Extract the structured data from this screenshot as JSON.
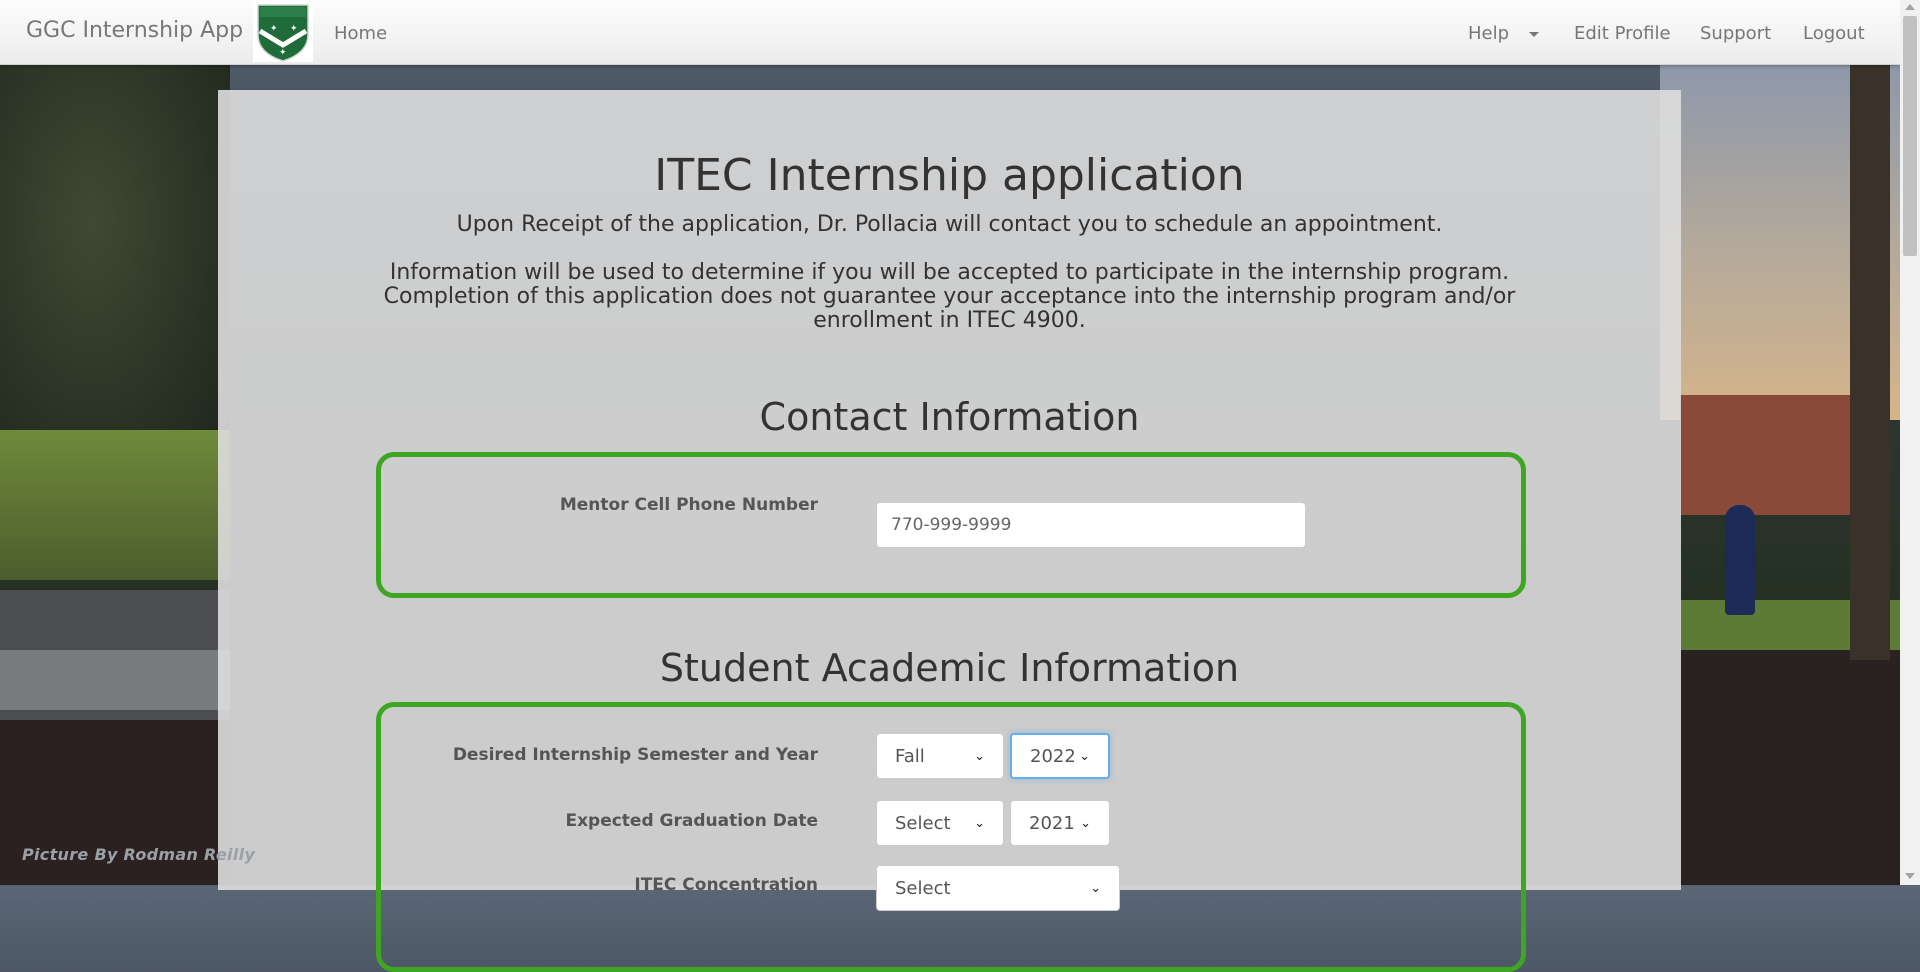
{
  "navbar": {
    "brand": "GGC Internship App",
    "logo": "Georgia Gwinnett College crest",
    "home": "Home",
    "help": "Help",
    "edit_profile": "Edit Profile",
    "support": "Support",
    "logout": "Logout"
  },
  "page": {
    "title": "ITEC Internship application",
    "intro_line1": "Upon Receipt of the application, Dr. Pollacia will contact you to schedule an appointment.",
    "intro_line2": "Information will be used to determine if you will be accepted to participate in the internship program.",
    "intro_line3": "Completion of this application does not guarantee your acceptance into the internship program and/or",
    "intro_line4": "enrollment in ITEC 4900."
  },
  "contact": {
    "heading": "Contact Information",
    "mentor_phone_label": "Mentor Cell Phone Number",
    "mentor_phone_placeholder": "770-999-9999"
  },
  "academic": {
    "heading": "Student Academic Information",
    "semester_label": "Desired Internship Semester and Year",
    "semester_value": "Fall",
    "semester_year_value": "2022",
    "graduation_label": "Expected Graduation Date",
    "graduation_value": "Select",
    "graduation_year_value": "2021",
    "concentration_label": "ITEC Concentration",
    "concentration_value": "Select"
  },
  "credit": "Picture By Rodman Reilly",
  "colors": {
    "fieldset_border": "#3fa624",
    "focus_ring": "#66afe9"
  }
}
